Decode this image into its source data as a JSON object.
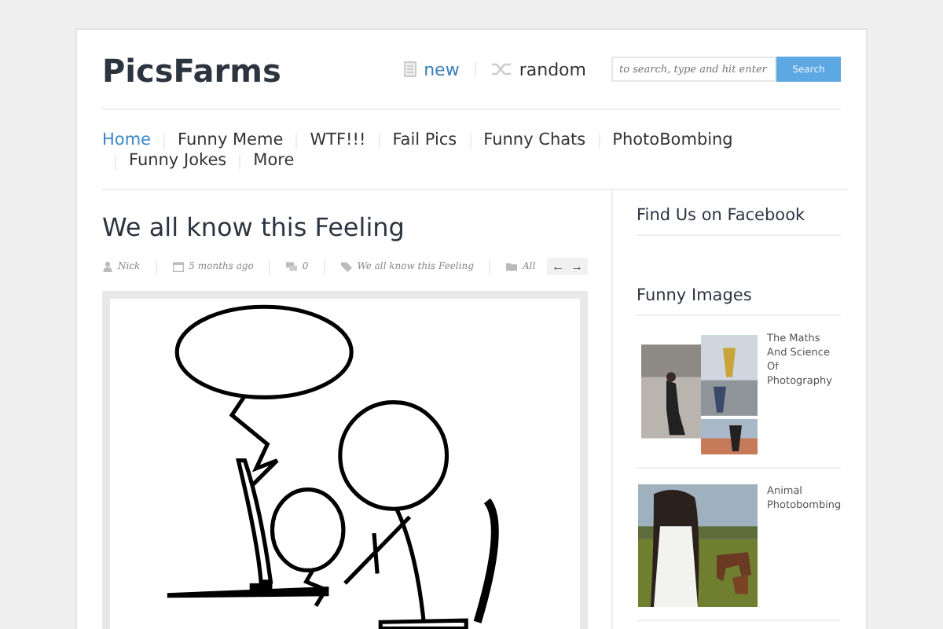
{
  "site": {
    "logo": "PicsFarms",
    "links": [
      {
        "label": "new",
        "kind": "new"
      },
      {
        "label": "random",
        "kind": "random"
      }
    ],
    "search": {
      "placeholder": "to search, type and hit enter",
      "button": "Search"
    }
  },
  "nav": [
    {
      "label": "Home",
      "selected": true
    },
    {
      "label": "Funny Meme",
      "selected": false
    },
    {
      "label": "WTF!!!",
      "selected": false
    },
    {
      "label": "Fail Pics",
      "selected": false
    },
    {
      "label": "Funny Chats",
      "selected": false
    },
    {
      "label": "PhotoBombing",
      "selected": false
    },
    {
      "label": "Funny Jokes",
      "selected": false
    },
    {
      "label": "More",
      "selected": false
    }
  ],
  "post": {
    "title": "We all know this Feeling",
    "meta": [
      {
        "kind": "author",
        "text": "Nick"
      },
      {
        "kind": "date",
        "text": "5 months ago"
      },
      {
        "kind": "comments",
        "text": "0"
      },
      {
        "kind": "tag",
        "text": "We all know this Feeling"
      },
      {
        "kind": "category",
        "text": "All"
      }
    ],
    "pager": [
      "←",
      "→"
    ]
  },
  "sidebar": [
    {
      "title": "Find Us on Facebook"
    },
    {
      "title": "Funny Images",
      "items": [
        {
          "title": "The Maths And Science Of Photography",
          "kind": "collage"
        },
        {
          "title": "Animal Photobombing",
          "kind": "field"
        }
      ]
    }
  ]
}
